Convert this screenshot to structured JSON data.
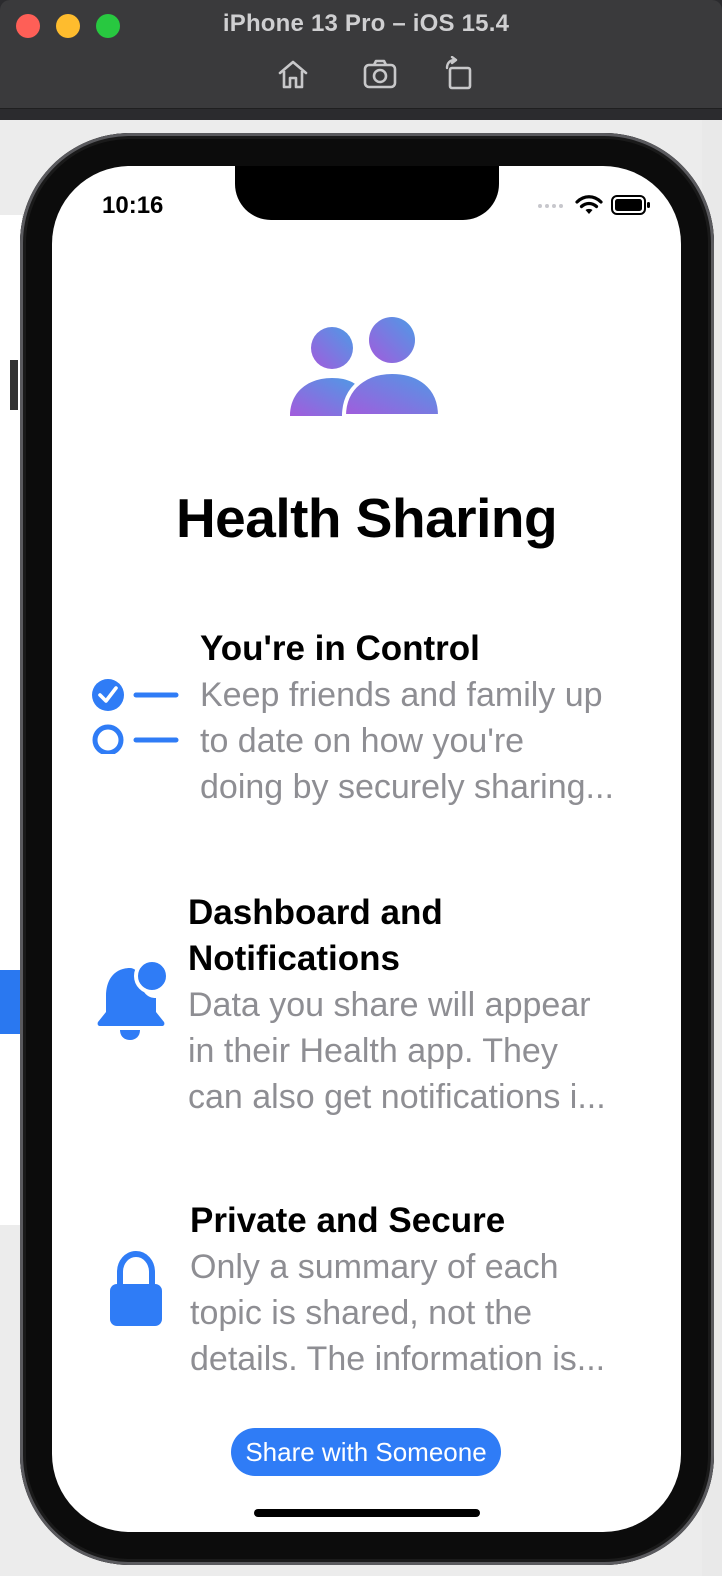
{
  "window": {
    "title": "iPhone 13 Pro – iOS 15.4"
  },
  "toolbar": {
    "buttons": [
      "home-icon",
      "screenshot-icon",
      "rotate-icon"
    ]
  },
  "status": {
    "time": "10:16"
  },
  "page": {
    "title": "Health Sharing"
  },
  "features": [
    {
      "icon": "checklist-icon",
      "title": "You're in Control",
      "lines": [
        "Keep friends and family up",
        "to date on how you're",
        "doing by securely sharing..."
      ]
    },
    {
      "icon": "bell-badge-icon",
      "title_lines": [
        "Dashboard and",
        "Notifications"
      ],
      "lines": [
        "Data you share will appear",
        "in their Health app. They",
        "can also get notifications i..."
      ]
    },
    {
      "icon": "lock-icon",
      "title": "Private and Secure",
      "lines": [
        "Only a summary of each",
        "topic is shared, not the",
        "details. The information is..."
      ]
    }
  ],
  "actions": {
    "share_label": "Share with Someone"
  },
  "colors": {
    "accent": "#2f7cf6",
    "secondary_text": "#8e8e93",
    "hero_gradient_start": "#9b5de5",
    "hero_gradient_end": "#4d9be6"
  }
}
